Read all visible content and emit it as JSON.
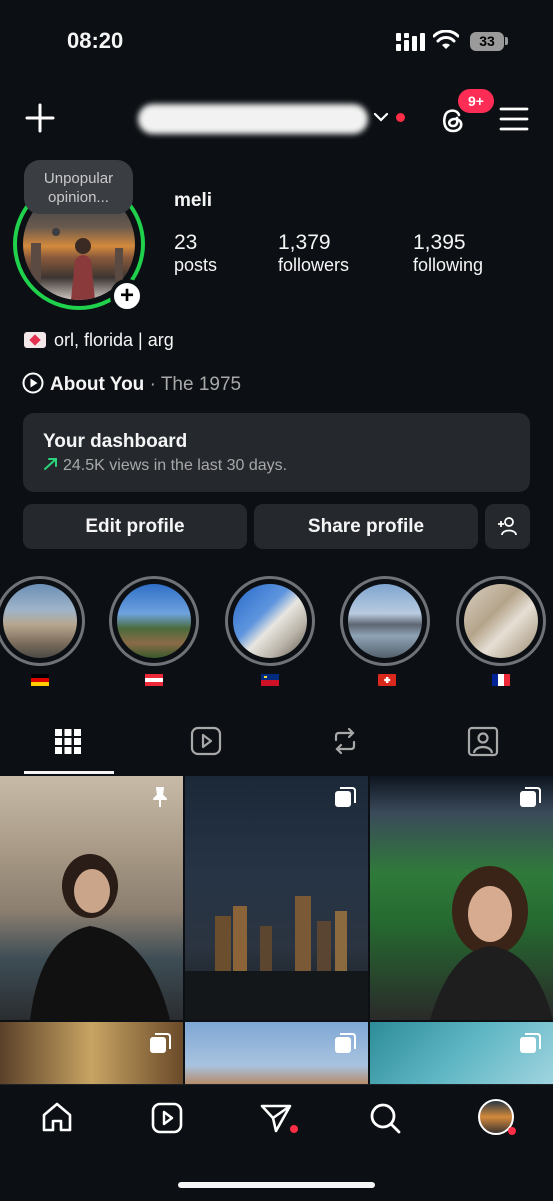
{
  "status_bar": {
    "time": "08:20",
    "battery": "33"
  },
  "header": {
    "notification_count": "9+",
    "icons": [
      "plus-icon",
      "chevron-down-icon",
      "threads-icon",
      "menu-icon"
    ]
  },
  "profile": {
    "note": "Unpopular opinion...",
    "display_name": "meli",
    "stats": [
      {
        "value": "23",
        "label": "posts"
      },
      {
        "value": "1,379",
        "label": "followers"
      },
      {
        "value": "1,395",
        "label": "following"
      }
    ],
    "bio": "orl, florida | arg",
    "music": {
      "title": "About You",
      "separator": "·",
      "artist": "The 1975"
    }
  },
  "dashboard": {
    "title": "Your dashboard",
    "subtitle": "24.5K views in the last 30 days."
  },
  "actions": {
    "edit": "Edit profile",
    "share": "Share profile"
  },
  "highlights": [
    {
      "flag": "germany"
    },
    {
      "flag": "austria"
    },
    {
      "flag": "liechtenstein"
    },
    {
      "flag": "switzerland"
    },
    {
      "flag": "france"
    }
  ],
  "tabs": [
    "grid-icon",
    "reels-icon",
    "reposts-icon",
    "tagged-icon"
  ],
  "colors": {
    "story_ring": "#1fd14b",
    "badge": "#ff2d55",
    "background": "#0c1014",
    "surface": "#25292e"
  }
}
